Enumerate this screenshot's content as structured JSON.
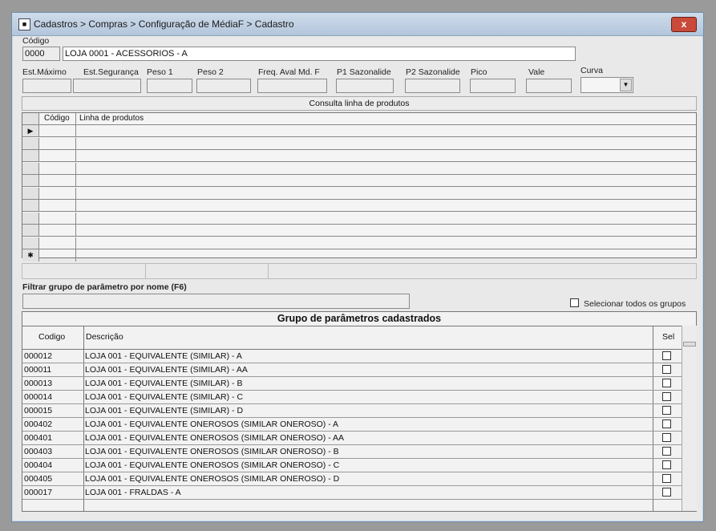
{
  "window": {
    "title": "Cadastros > Compras > Configuração de MédiaF > Cadastro",
    "close_glyph": "x"
  },
  "form": {
    "codigo_label": "Código",
    "codigo_value": "0000",
    "descricao_value": "LOJA 0001 - ACESSORIOS - A",
    "labels": {
      "est_maximo": "Est.Máximo",
      "est_seguranca": "Est.Segurança",
      "peso1": "Peso 1",
      "peso2": "Peso 2",
      "freq_aval": "Freq. Aval Md. F",
      "p1_sazonalide": "P1 Sazonalide",
      "p2_sazonalide": "P2 Sazonalide",
      "pico": "Pico",
      "vale": "Vale",
      "curva": "Curva"
    }
  },
  "linha_produtos": {
    "header": "Consulta linha de produtos",
    "columns": [
      "Código",
      "Linha de produtos"
    ],
    "row_count": 10
  },
  "filtro": {
    "label": "Filtrar grupo de parâmetro por nome (F6)",
    "value": "",
    "select_all_label": "Selecionar todos os grupos"
  },
  "grupos": {
    "title": "Grupo de parâmetros cadastrados",
    "columns": {
      "codigo": "Codigo",
      "descricao": "Descrição",
      "sel": "Sel"
    },
    "rows": [
      {
        "codigo": "000012",
        "descricao": "LOJA 001 - EQUIVALENTE (SIMILAR) - A"
      },
      {
        "codigo": "000011",
        "descricao": "LOJA 001 - EQUIVALENTE (SIMILAR) - AA"
      },
      {
        "codigo": "000013",
        "descricao": "LOJA 001 - EQUIVALENTE (SIMILAR) - B"
      },
      {
        "codigo": "000014",
        "descricao": "LOJA 001 - EQUIVALENTE (SIMILAR) - C"
      },
      {
        "codigo": "000015",
        "descricao": "LOJA 001 - EQUIVALENTE (SIMILAR) - D"
      },
      {
        "codigo": "000402",
        "descricao": "LOJA 001 - EQUIVALENTE ONEROSOS (SIMILAR ONEROSO) - A"
      },
      {
        "codigo": "000401",
        "descricao": "LOJA 001 - EQUIVALENTE ONEROSOS (SIMILAR ONEROSO) - AA"
      },
      {
        "codigo": "000403",
        "descricao": "LOJA 001 - EQUIVALENTE ONEROSOS (SIMILAR ONEROSO) - B"
      },
      {
        "codigo": "000404",
        "descricao": "LOJA 001 - EQUIVALENTE ONEROSOS (SIMILAR ONEROSO) - C"
      },
      {
        "codigo": "000405",
        "descricao": "LOJA 001 - EQUIVALENTE ONEROSOS (SIMILAR ONEROSO) - D"
      },
      {
        "codigo": "000017",
        "descricao": "LOJA 001 - FRALDAS - A"
      }
    ]
  }
}
